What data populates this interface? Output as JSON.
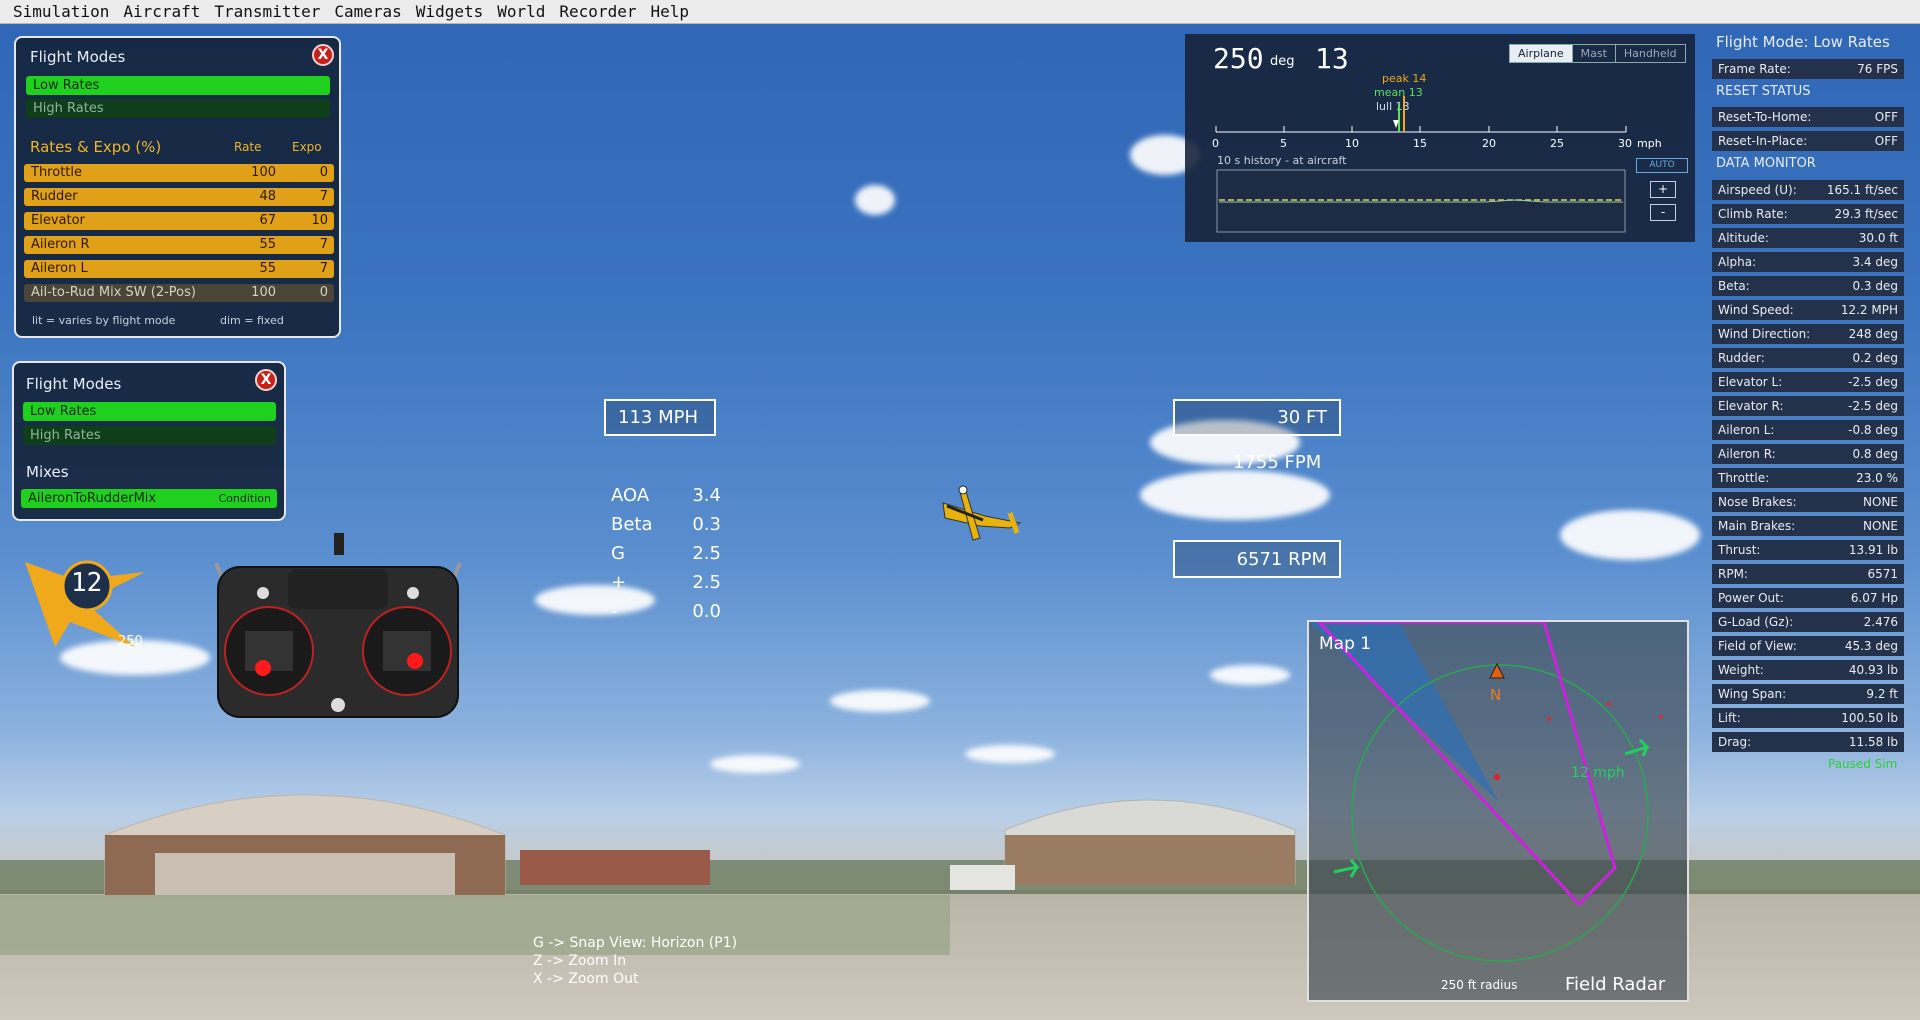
{
  "menu": [
    "Simulation",
    "Aircraft",
    "Transmitter",
    "Cameras",
    "Widgets",
    "World",
    "Recorder",
    "Help"
  ],
  "panel1": {
    "title": "Flight Modes",
    "close": "X",
    "modes": [
      "Low Rates",
      "High Rates"
    ],
    "rates_title": "Rates & Expo (%)",
    "col_rate": "Rate",
    "col_expo": "Expo",
    "rows": [
      {
        "name": "Throttle",
        "rate": "100",
        "expo": "0"
      },
      {
        "name": "Rudder",
        "rate": "48",
        "expo": "7"
      },
      {
        "name": "Elevator",
        "rate": "67",
        "expo": "10"
      },
      {
        "name": "Aileron R",
        "rate": "55",
        "expo": "7"
      },
      {
        "name": "Aileron L",
        "rate": "55",
        "expo": "7"
      },
      {
        "name": "Ail-to-Rud Mix SW (2-Pos)",
        "rate": "100",
        "expo": "0"
      }
    ],
    "footer_lit": "lit = varies by flight mode",
    "footer_dim": "dim = fixed"
  },
  "panel2": {
    "title": "Flight Modes",
    "close": "X",
    "modes": [
      "Low Rates",
      "High Rates"
    ],
    "mixes_title": "Mixes",
    "mix_name": "AileronToRudderMix",
    "mix_tag": "Condition"
  },
  "wind_compass": {
    "speed": "12",
    "direction": "250"
  },
  "hud": {
    "speed": "113 MPH",
    "altitude": "30 FT",
    "climb": "1755 FPM",
    "rpm": "6571 RPM",
    "params": [
      {
        "k": "AOA",
        "v": "3.4"
      },
      {
        "k": "Beta",
        "v": "0.3"
      },
      {
        "k": "G",
        "v": "2.5"
      },
      {
        "k": "+",
        "v": "2.5"
      },
      {
        "k": "-",
        "v": "0.0"
      }
    ]
  },
  "wind_widget": {
    "direction": "250",
    "unit": "deg",
    "speed": "13",
    "tabs": [
      "Airplane",
      "Mast",
      "Handheld"
    ],
    "peak": "peak 14",
    "mean": "mean 13",
    "lull": "lull 13",
    "scale": [
      "0",
      "5",
      "10",
      "15",
      "20",
      "25",
      "30"
    ],
    "scale_unit": "mph",
    "history": "10 s history - at aircraft",
    "auto": "AUTO",
    "plus": "+",
    "minus": "-"
  },
  "data_panel": {
    "title": "Flight Mode: Low Rates",
    "frame_rate": {
      "l": "Frame Rate:",
      "v": "76 FPS"
    },
    "reset_title": "RESET STATUS",
    "reset": [
      {
        "l": "Reset-To-Home:",
        "v": "OFF"
      },
      {
        "l": "Reset-In-Place:",
        "v": "OFF"
      }
    ],
    "monitor_title": "DATA MONITOR",
    "rows": [
      {
        "l": "Airspeed (U):",
        "v": "165.1 ft/sec"
      },
      {
        "l": "Climb Rate:",
        "v": "29.3 ft/sec"
      },
      {
        "l": "Altitude:",
        "v": "30.0 ft"
      },
      {
        "l": "Alpha:",
        "v": "3.4 deg"
      },
      {
        "l": "Beta:",
        "v": "0.3 deg"
      },
      {
        "l": "Wind Speed:",
        "v": "12.2 MPH"
      },
      {
        "l": "Wind Direction:",
        "v": "248 deg"
      },
      {
        "l": "Rudder:",
        "v": "0.2 deg"
      },
      {
        "l": "Elevator L:",
        "v": "-2.5 deg"
      },
      {
        "l": "Elevator R:",
        "v": "-2.5 deg"
      },
      {
        "l": "Aileron L:",
        "v": "-0.8 deg"
      },
      {
        "l": "Aileron R:",
        "v": "0.8 deg"
      },
      {
        "l": "Throttle:",
        "v": "23.0 %"
      },
      {
        "l": "Nose Brakes:",
        "v": "NONE"
      },
      {
        "l": "Main Brakes:",
        "v": "NONE"
      },
      {
        "l": "Thrust:",
        "v": "13.91 lb"
      },
      {
        "l": "RPM:",
        "v": "6571"
      },
      {
        "l": "Power Out:",
        "v": "6.07 Hp"
      },
      {
        "l": "G-Load (Gz):",
        "v": "2.476"
      },
      {
        "l": "Field of View:",
        "v": "45.3 deg"
      },
      {
        "l": "Weight:",
        "v": "40.93 lb"
      },
      {
        "l": "Wing Span:",
        "v": "9.2 ft"
      },
      {
        "l": "Lift:",
        "v": "100.50 lb"
      },
      {
        "l": "Drag:",
        "v": "11.58 lb"
      }
    ],
    "paused": "Paused Sim"
  },
  "map": {
    "title": "Map 1",
    "north": "N",
    "wind": "12 mph",
    "radius": "250 ft radius",
    "label": "Field Radar"
  },
  "hints": [
    "G -> Snap View: Horizon (P1)",
    "Z -> Zoom In",
    "X -> Zoom Out"
  ],
  "colors": {
    "accent_green": "#1fd01f",
    "rate_orange": "#e0a018",
    "magenta": "#cc22dd",
    "radar_green": "#1fbf4f"
  }
}
